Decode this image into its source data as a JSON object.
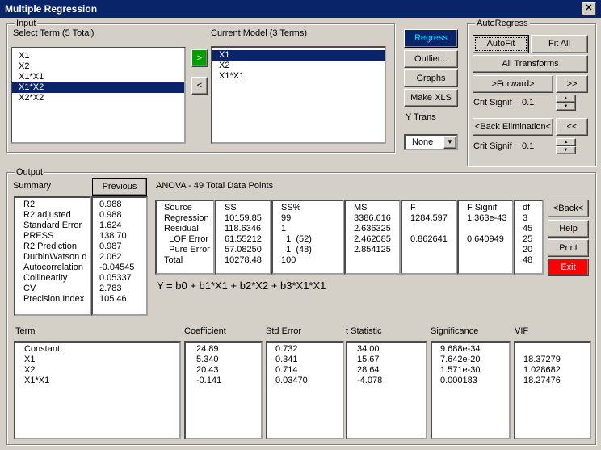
{
  "window": {
    "title": "Multiple Regression",
    "close": "✕"
  },
  "input": {
    "group_label": "Input",
    "select_label": "Select Term (5 Total)",
    "terms": [
      "X1",
      "X2",
      "X1*X1",
      "X1*X2",
      "X2*X2"
    ],
    "selected_term_index": 3,
    "model_label": "Current Model (3 Terms)",
    "model_terms": [
      "X1",
      "X2",
      "X1*X1"
    ],
    "selected_model_index": 0,
    "add_btn": ">",
    "remove_btn": "<"
  },
  "actions": {
    "regress": "Regress",
    "outlier": "Outlier...",
    "graphs": "Graphs",
    "make_xls": "Make XLS",
    "ytrans_label": "Y Trans",
    "ytrans_value": "None"
  },
  "autoregress": {
    "group_label": "AutoRegress",
    "autofit": "AutoFit",
    "fitall": "Fit All",
    "alltransforms": "All Transforms",
    "forward": ">Forward>",
    "forward_all": ">>",
    "crit_label_1": "Crit Signif",
    "crit_value_1": "0.1",
    "back": "<Back Elimination<",
    "back_all": "<<",
    "crit_label_2": "Crit Signif",
    "crit_value_2": "0.1"
  },
  "output": {
    "group_label": "Output",
    "summary_label": "Summary",
    "previous": "Previous",
    "summary_names": "R2\nR2 adjusted\nStandard Error\nPRESS\nR2 Prediction\nDurbinWatson d\nAutocorrelation\nCollinearity\nCV\nPrecision Index",
    "summary_values": "0.988\n0.988\n1.624\n138.70\n0.987\n2.062\n-0.04545\n0.05337\n2.783\n105.46",
    "anova_title": "ANOVA - 49 Total Data Points",
    "anova": {
      "source": "Source\nRegression\nResidual\n  LOF Error\n  Pure Error\nTotal",
      "ss": "SS\n10159.85\n118.6346\n61.55212\n57.08250\n10278.48",
      "sspct": "SS%\n99\n1\n  1  (52)\n  1  (48)\n100",
      "ms": "MS\n3386.616\n2.636325\n2.462085\n2.854125",
      "f": "F\n1284.597\n\n0.862641",
      "fsig": "F Signif\n1.363e-43\n\n0.640949",
      "df": "df\n3\n45\n25\n20\n48"
    },
    "equation": "Y = b0 + b1*X1 + b2*X2 + b3*X1*X1",
    "back_btn": "<Back<",
    "help_btn": "Help",
    "print_btn": "Print",
    "exit_btn": "Exit",
    "coef_headers": {
      "term": "Term",
      "coef": "Coefficient",
      "stderr": "Std Error",
      "tstat": "t Statistic",
      "sig": "Significance",
      "vif": "VIF"
    },
    "coef": {
      "term": "Constant\nX1\nX2\nX1*X1",
      "coef": "24.89\n5.340\n20.43\n-0.141",
      "stderr": "0.732\n0.341\n0.714\n0.03470",
      "tstat": "34.00\n15.67\n28.64\n-4.078",
      "sig": "9.688e-34\n7.642e-20\n1.571e-30\n0.000183",
      "vif": "\n18.37279\n1.028682\n18.27476"
    }
  },
  "colors": {
    "title_bg": "#0a246a",
    "regress_text": "#0000ff",
    "exit_bg": "#ff0000",
    "add_btn_bg": "#00a000"
  }
}
